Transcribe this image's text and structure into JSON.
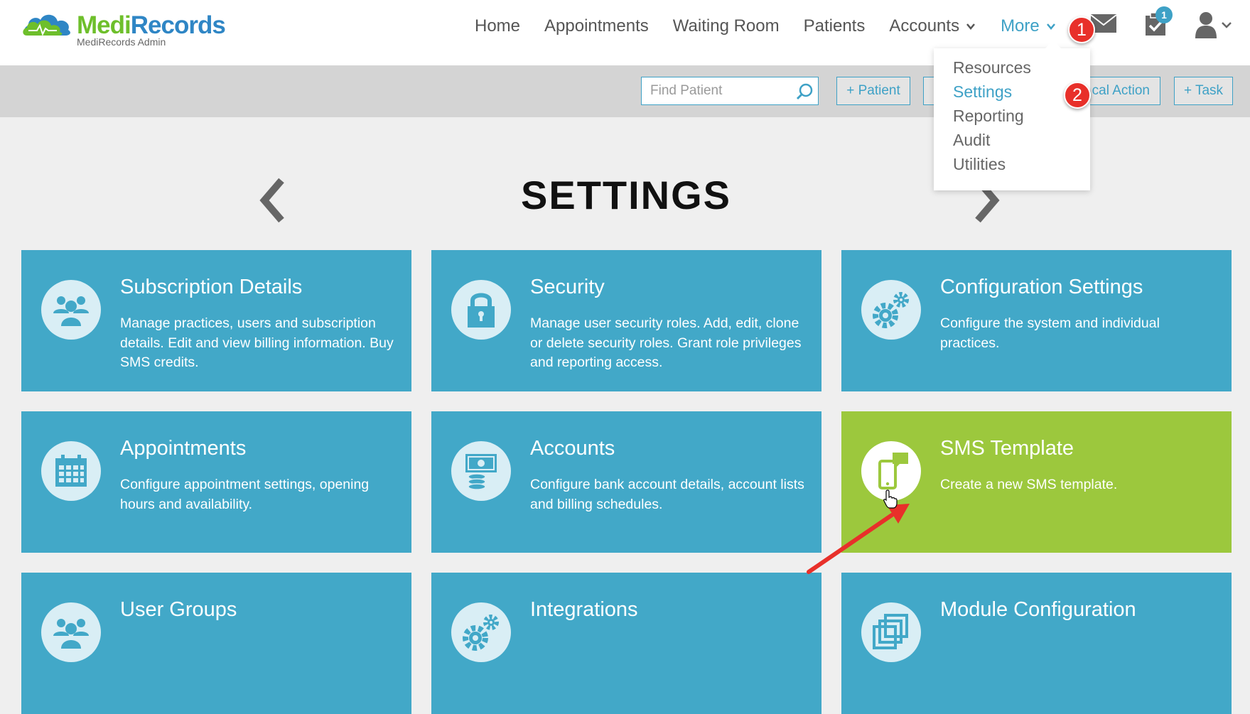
{
  "header": {
    "logo_medi": "Medi",
    "logo_records": "Records",
    "logo_subtitle": "MediRecords Admin",
    "nav": [
      {
        "label": "Home"
      },
      {
        "label": "Appointments"
      },
      {
        "label": "Waiting Room"
      },
      {
        "label": "Patients"
      },
      {
        "label": "Accounts"
      },
      {
        "label": "More"
      }
    ],
    "task_count": "1"
  },
  "toolbar": {
    "search_placeholder": "Find Patient",
    "buttons": [
      {
        "label": "+ Patient"
      },
      {
        "label": ""
      },
      {
        "label": "cal Action"
      },
      {
        "label": "+ Task"
      }
    ]
  },
  "more_menu": {
    "items": [
      {
        "label": "Resources"
      },
      {
        "label": "Settings"
      },
      {
        "label": "Reporting"
      },
      {
        "label": "Audit"
      },
      {
        "label": "Utilities"
      }
    ]
  },
  "annotations": {
    "step1": "1",
    "step2": "2"
  },
  "page": {
    "title": "SETTINGS"
  },
  "tiles": [
    {
      "title": "Subscription Details",
      "desc": "Manage practices, users and subscription details. Edit and view billing information. Buy SMS credits.",
      "icon": "users-icon"
    },
    {
      "title": "Security",
      "desc": "Manage user security roles. Add, edit, clone or delete security roles. Grant role privileges and reporting access.",
      "icon": "lock-icon"
    },
    {
      "title": "Configuration Settings",
      "desc": "Configure the system and individual practices.",
      "icon": "gears-icon"
    },
    {
      "title": "Appointments",
      "desc": "Configure appointment settings, opening hours and availability.",
      "icon": "calendar-icon"
    },
    {
      "title": "Accounts",
      "desc": "Configure bank account details, account lists and billing schedules.",
      "icon": "money-icon"
    },
    {
      "title": "SMS Template",
      "desc": "Create a new SMS template.",
      "icon": "phone-sms-icon"
    },
    {
      "title": "User Groups",
      "desc": "",
      "icon": "users-icon"
    },
    {
      "title": "Integrations",
      "desc": "",
      "icon": "gears-icon"
    },
    {
      "title": "Module Configuration",
      "desc": "",
      "icon": "modules-icon"
    }
  ],
  "colors": {
    "tile_blue": "#42a8c8",
    "tile_green": "#9cc83d",
    "accent": "#3ea1c6",
    "marker_red": "#e8302a"
  }
}
